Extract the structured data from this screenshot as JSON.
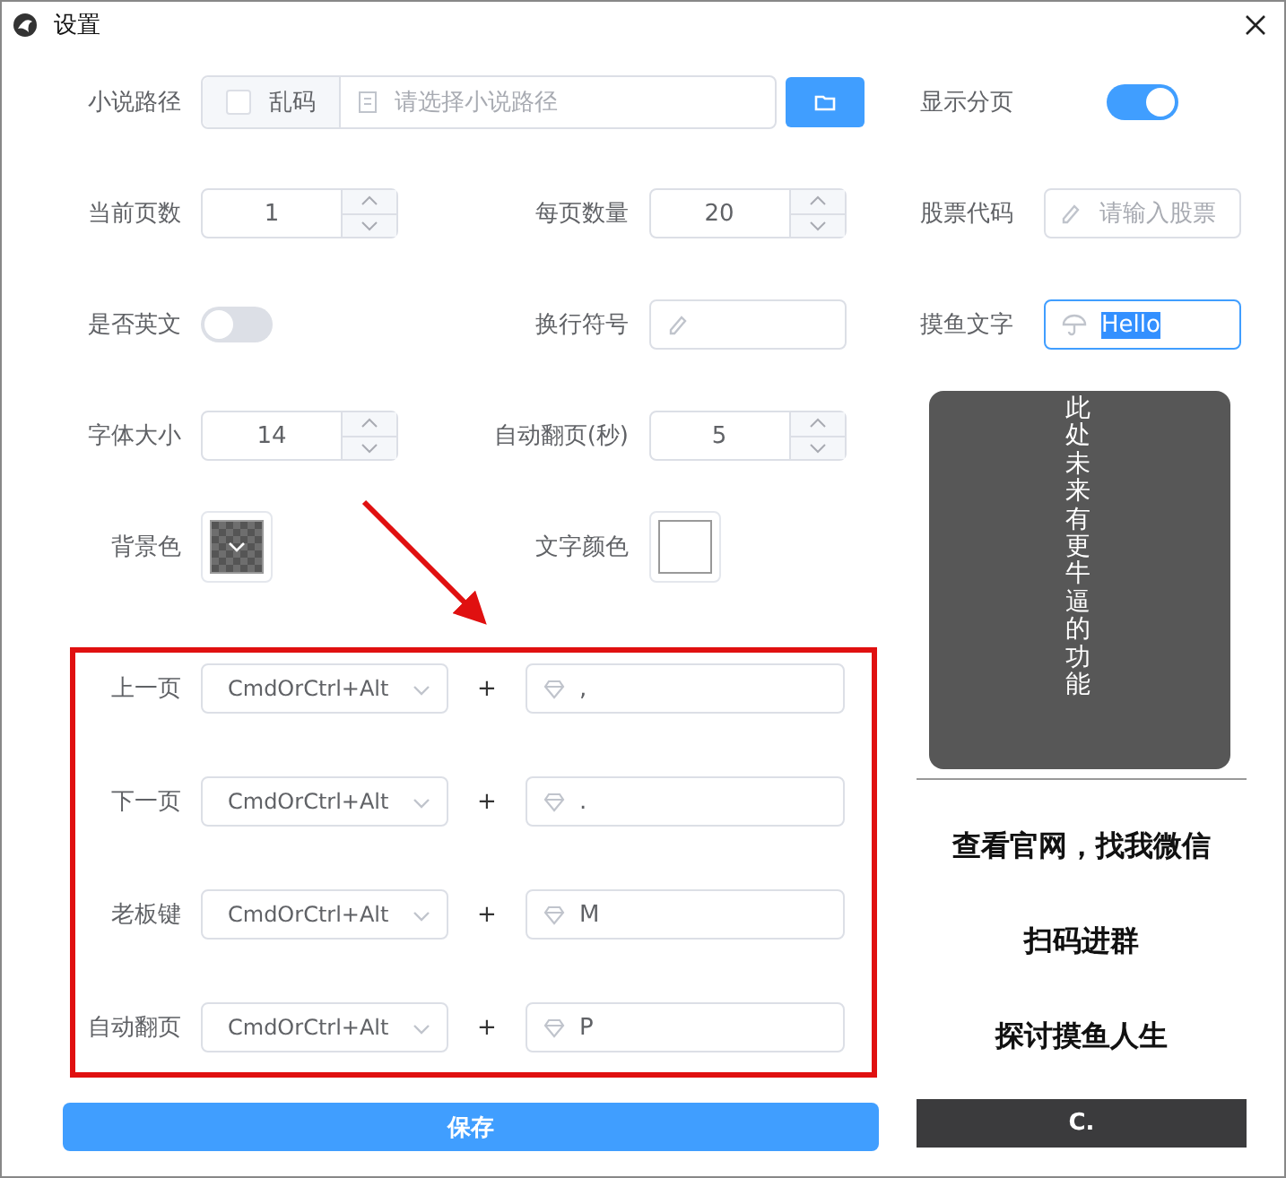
{
  "window": {
    "title": "设置"
  },
  "rows": [
    {
      "fields": [
        {
          "kind": "path",
          "label": "小说路径",
          "checkbox": {
            "label": "乱码",
            "checked": false
          },
          "placeholder": "请选择小说路径"
        }
      ]
    },
    {
      "fields": [
        {
          "kind": "number",
          "label": "当前页数",
          "value": "1"
        },
        {
          "kind": "number",
          "label": "每页数量",
          "value": "20"
        }
      ]
    },
    {
      "fields": [
        {
          "kind": "switch",
          "label": "是否英文",
          "on": false
        },
        {
          "kind": "text",
          "label": "换行符号"
        }
      ]
    },
    {
      "fields": [
        {
          "kind": "number",
          "label": "字体大小",
          "value": "14"
        },
        {
          "kind": "number",
          "label": "自动翻页(秒)",
          "value": "5"
        }
      ]
    },
    {
      "fields": [
        {
          "kind": "color",
          "label": "背景色",
          "color": "#555555"
        },
        {
          "kind": "color",
          "label": "文字颜色",
          "color": "#ffffff"
        }
      ]
    }
  ],
  "side_fields": [
    {
      "kind": "switch",
      "label": "显示分页",
      "on": true
    },
    {
      "kind": "text",
      "label": "股票代码",
      "placeholder": "请输入股票"
    },
    {
      "kind": "text",
      "label": "摸鱼文字",
      "value": "Hello",
      "focused": true,
      "text_selected": true
    }
  ],
  "shortcuts": {
    "highlighted": true,
    "rows": [
      {
        "label": "上一页",
        "modifier": "CmdOrCtrl+Alt",
        "joiner": "+",
        "key": ","
      },
      {
        "label": "下一页",
        "modifier": "CmdOrCtrl+Alt",
        "joiner": "+",
        "key": "."
      },
      {
        "label": "老板键",
        "modifier": "CmdOrCtrl+Alt",
        "joiner": "+",
        "key": "M"
      },
      {
        "label": "自动翻页",
        "modifier": "CmdOrCtrl+Alt",
        "joiner": "+",
        "key": "P"
      }
    ]
  },
  "save_button": "保存",
  "side_panel": {
    "notice": "此处未来有更牛逼的功能",
    "lines": [
      "查看官网，找我微信",
      "扫码进群",
      "探讨摸鱼人生"
    ],
    "footer": "C."
  }
}
